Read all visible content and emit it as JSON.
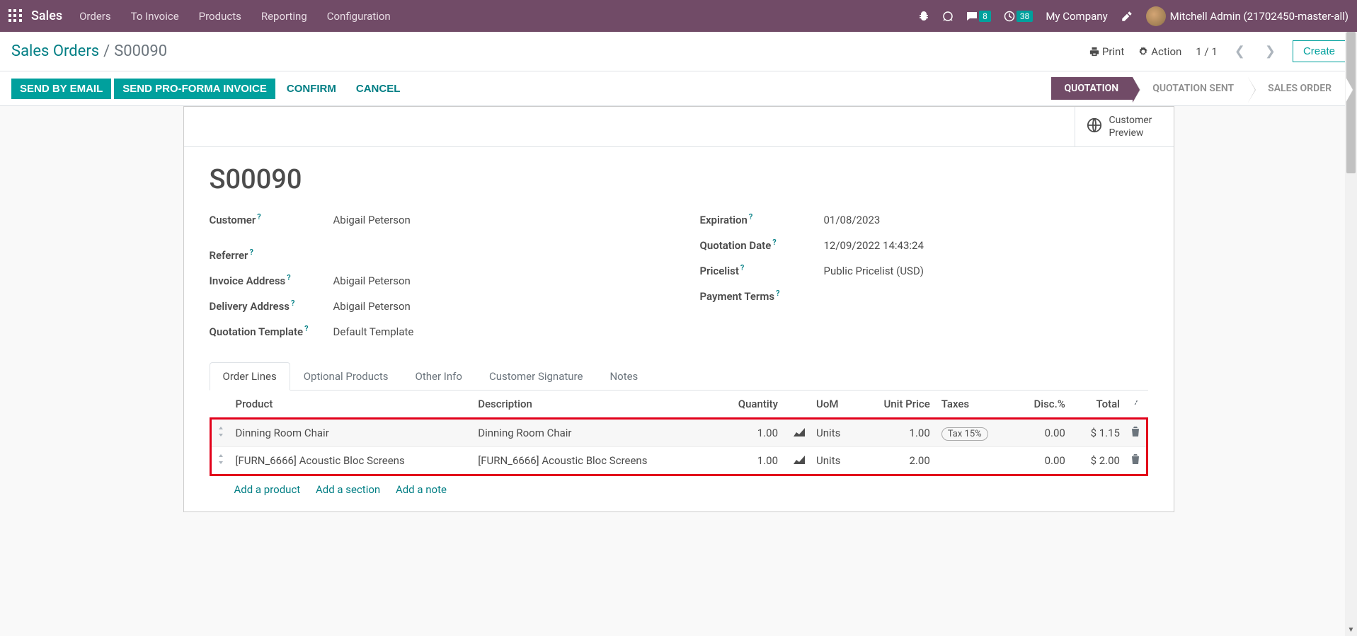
{
  "navbar": {
    "brand": "Sales",
    "menu": [
      "Orders",
      "To Invoice",
      "Products",
      "Reporting",
      "Configuration"
    ],
    "messages_badge": "8",
    "activities_badge": "38",
    "company": "My Company",
    "user": "Mitchell Admin (21702450-master-all)"
  },
  "controlbar": {
    "breadcrumb_root": "Sales Orders",
    "breadcrumb_current": "S00090",
    "print": "Print",
    "action": "Action",
    "pager": "1 / 1",
    "create": "Create"
  },
  "statusbar": {
    "send_email": "SEND BY EMAIL",
    "send_proforma": "SEND PRO-FORMA INVOICE",
    "confirm": "CONFIRM",
    "cancel": "CANCEL",
    "stages": [
      "QUOTATION",
      "QUOTATION SENT",
      "SALES ORDER"
    ]
  },
  "statbox": {
    "customer_preview_l1": "Customer",
    "customer_preview_l2": "Preview"
  },
  "record": {
    "title": "S00090",
    "labels": {
      "customer": "Customer",
      "referrer": "Referrer",
      "invoice_address": "Invoice Address",
      "delivery_address": "Delivery Address",
      "quotation_template": "Quotation Template",
      "expiration": "Expiration",
      "quotation_date": "Quotation Date",
      "pricelist": "Pricelist",
      "payment_terms": "Payment Terms"
    },
    "values": {
      "customer": "Abigail Peterson",
      "referrer": "",
      "invoice_address": "Abigail Peterson",
      "delivery_address": "Abigail Peterson",
      "quotation_template": "Default Template",
      "expiration": "01/08/2023",
      "quotation_date": "12/09/2022 14:43:24",
      "pricelist": "Public Pricelist (USD)",
      "payment_terms": ""
    }
  },
  "tabs": [
    "Order Lines",
    "Optional Products",
    "Other Info",
    "Customer Signature",
    "Notes"
  ],
  "table": {
    "headers": {
      "product": "Product",
      "description": "Description",
      "quantity": "Quantity",
      "uom": "UoM",
      "unit_price": "Unit Price",
      "taxes": "Taxes",
      "disc": "Disc.%",
      "total": "Total"
    },
    "rows": [
      {
        "product": "Dinning Room Chair",
        "description": "Dinning Room Chair",
        "quantity": "1.00",
        "uom": "Units",
        "unit_price": "1.00",
        "tax": "Tax 15%",
        "disc": "0.00",
        "total": "$ 1.15"
      },
      {
        "product": "[FURN_6666] Acoustic Bloc Screens",
        "description": "[FURN_6666] Acoustic Bloc Screens",
        "quantity": "1.00",
        "uom": "Units",
        "unit_price": "2.00",
        "tax": "",
        "disc": "0.00",
        "total": "$ 2.00"
      }
    ],
    "footer": {
      "add_product": "Add a product",
      "add_section": "Add a section",
      "add_note": "Add a note"
    }
  },
  "help": "?"
}
